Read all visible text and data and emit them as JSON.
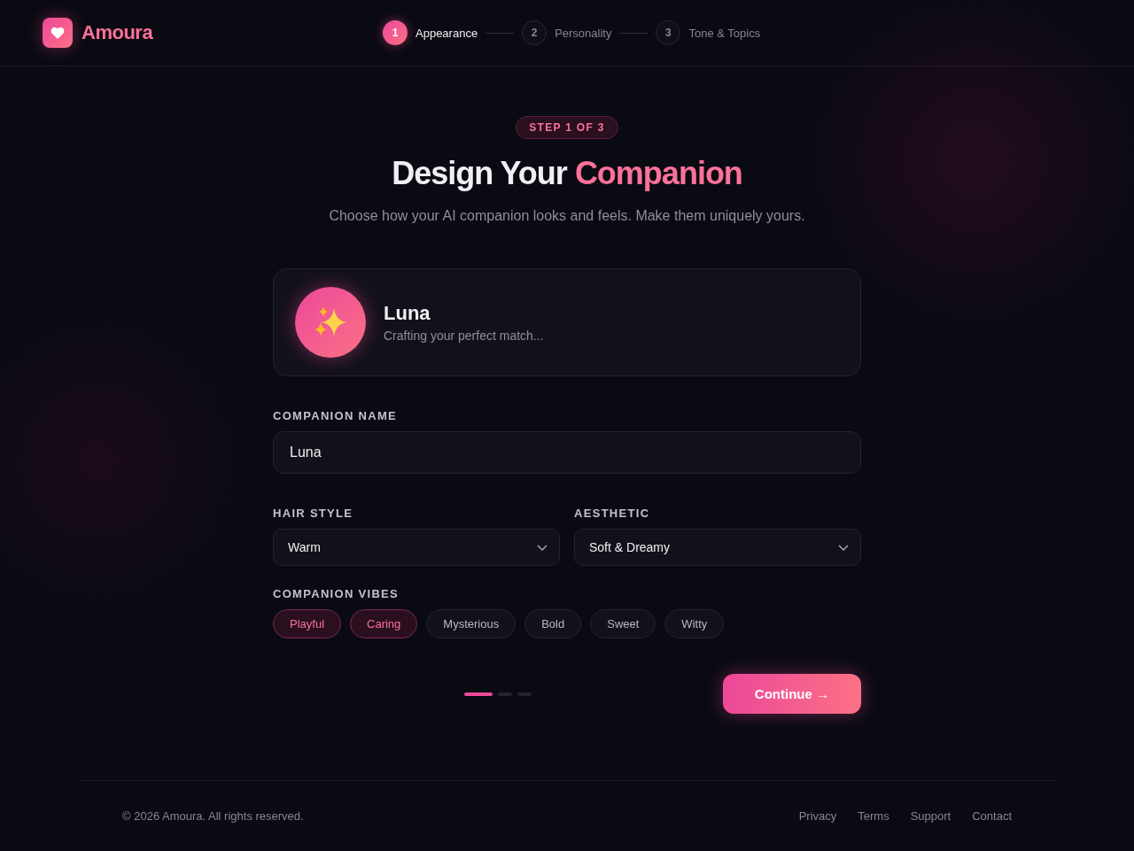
{
  "brand": {
    "name": "Amoura"
  },
  "steps": [
    {
      "number": "1",
      "label": "Appearance",
      "selected": true
    },
    {
      "number": "2",
      "label": "Personality",
      "selected": false
    },
    {
      "number": "3",
      "label": "Tone & Topics",
      "selected": false
    }
  ],
  "badge": "STEP 1 OF 3",
  "title": {
    "text": "Design Your",
    "accent": "Companion"
  },
  "subtitle": "Choose how your AI companion looks and feels. Make them uniquely yours.",
  "preview": {
    "name": "Luna",
    "caption": "Crafting your perfect match..."
  },
  "name_field": {
    "label": "COMPANION NAME",
    "value": "Luna"
  },
  "selects": [
    {
      "label": "HAIR STYLE",
      "value": "Warm"
    },
    {
      "label": "AESTHETIC",
      "value": "Soft & Dreamy"
    }
  ],
  "vibes": {
    "label": "COMPANION VIBES",
    "options": [
      {
        "label": "Playful",
        "selected": true
      },
      {
        "label": "Caring",
        "selected": true
      },
      {
        "label": "Mysterious",
        "selected": false
      },
      {
        "label": "Bold",
        "selected": false
      },
      {
        "label": "Sweet",
        "selected": false
      },
      {
        "label": "Witty",
        "selected": false
      }
    ]
  },
  "progress": [
    {
      "selected": true
    },
    {
      "selected": false
    },
    {
      "selected": false
    }
  ],
  "continue_button": "Continue →",
  "footer": {
    "copyright": "© 2026 Amoura. All rights reserved.",
    "links": [
      "Privacy",
      "Terms",
      "Support",
      "Contact"
    ]
  }
}
